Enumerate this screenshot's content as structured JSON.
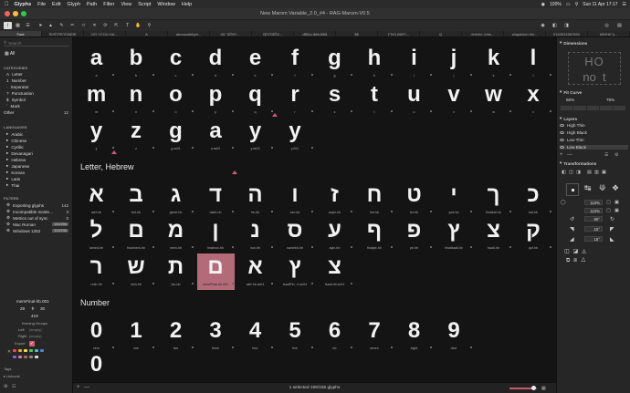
{
  "menubar": {
    "app": "Glyphs",
    "items": [
      "File",
      "Edit",
      "Glyph",
      "Path",
      "Filter",
      "View",
      "Script",
      "Window",
      "Help"
    ],
    "battery": "100%",
    "clock": "Sun 11 Apr  17:17"
  },
  "window": {
    "title": "New Marom Variable_2.0_#4 - RAG-Marom-V0.5"
  },
  "tabs": [
    "Font",
    "פנקאותהפדותאות",
    "DO YCOU HA...",
    "A",
    "abcasadefghi...",
    "ויאלטר עט ...",
    "עלסגדותבו...",
    "v$$4a-$8ie8l8$",
    "$$",
    "ראשון בארץ...",
    "Q",
    "Jericho John...",
    "shaydcion blo...",
    "0162634567890",
    "MWHKןך..."
  ],
  "sidebar": {
    "search_placeholder": "Search",
    "all_label": "All",
    "categories_title": "CATEGORIES",
    "categories": [
      {
        "label": "Letter",
        "icon": "A",
        "count": ""
      },
      {
        "label": "Number",
        "icon": "1",
        "count": ""
      },
      {
        "label": "Separator",
        "icon": "·",
        "count": ""
      },
      {
        "label": "Punctuation",
        "icon": "?",
        "count": ""
      },
      {
        "label": "Symbol",
        "icon": "$",
        "count": ""
      },
      {
        "label": "Mark",
        "icon": "´",
        "count": ""
      },
      {
        "label": "Other",
        "icon": "",
        "count": "12"
      }
    ],
    "languages_title": "LANGUAGES",
    "languages": [
      "Arabic",
      "Chinese",
      "Cyrillic",
      "Devanagari",
      "Hebrew",
      "Japanese",
      "Korean",
      "Latin",
      "Thai"
    ],
    "filters_title": "FILTERS",
    "filters": [
      {
        "label": "Exporting glyphs",
        "count": "142",
        "boxed": false
      },
      {
        "label": "Incompatible maste...",
        "count": "3",
        "boxed": false
      },
      {
        "label": "Metrics out of sync",
        "count": "0",
        "boxed": false
      },
      {
        "label": "Mac Roman",
        "count": "150/256",
        "boxed": true
      },
      {
        "label": "Windows 1252",
        "count": "102/236",
        "boxed": true
      }
    ],
    "glyph_info": {
      "name": "memFinal-hb.001",
      "lsb": "29",
      "rsb": "30",
      "width": "419",
      "kerning_title": "Kerning Groups",
      "left_label": "Left",
      "left_value": "(empty)",
      "right_label": "Right",
      "right_value": "(empty)",
      "export_label": "Export"
    },
    "tags_title": "Tags",
    "unicode_label": "Unicode"
  },
  "sections": {
    "hebrew_title": "Letter, Hebrew",
    "number_title": "Number"
  },
  "latin_row1": [
    {
      "g": "a",
      "n": "a"
    },
    {
      "g": "b",
      "n": "b"
    },
    {
      "g": "c",
      "n": "c"
    },
    {
      "g": "d",
      "n": "d"
    },
    {
      "g": "e",
      "n": "e"
    },
    {
      "g": "f",
      "n": "f"
    },
    {
      "g": "g",
      "n": "g"
    },
    {
      "g": "h",
      "n": "h"
    },
    {
      "g": "i",
      "n": "i"
    },
    {
      "g": "j",
      "n": "j"
    },
    {
      "g": "k",
      "n": "k"
    },
    {
      "g": "l",
      "n": "l"
    }
  ],
  "latin_row2": [
    {
      "g": "m",
      "n": "m"
    },
    {
      "g": "n",
      "n": "n"
    },
    {
      "g": "o",
      "n": "o"
    },
    {
      "g": "p",
      "n": "p"
    },
    {
      "g": "q",
      "n": "q"
    },
    {
      "g": "r",
      "n": "r"
    },
    {
      "g": "s",
      "n": "s"
    },
    {
      "g": "t",
      "n": "t"
    },
    {
      "g": "u",
      "n": "u"
    },
    {
      "g": "v",
      "n": "v"
    },
    {
      "g": "w",
      "n": "w"
    },
    {
      "g": "x",
      "n": "x"
    }
  ],
  "latin_row3": [
    {
      "g": "y",
      "n": "y"
    },
    {
      "g": "z",
      "n": "z"
    },
    {
      "g": "g",
      "n": "g.ss01"
    },
    {
      "g": "a",
      "n": "a.ss02"
    },
    {
      "g": "y",
      "n": "y.ss03"
    },
    {
      "g": "y",
      "n": "y.001"
    }
  ],
  "hebrew_row1": [
    {
      "g": "א",
      "n": "alef-hb"
    },
    {
      "g": "ב",
      "n": "bet-hb"
    },
    {
      "g": "ג",
      "n": "gimel-hb"
    },
    {
      "g": "ד",
      "n": "dalet-hb"
    },
    {
      "g": "ה",
      "n": "he-hb"
    },
    {
      "g": "ו",
      "n": "vav-hb"
    },
    {
      "g": "ז",
      "n": "zayin-hb"
    },
    {
      "g": "ח",
      "n": "het-hb"
    },
    {
      "g": "ט",
      "n": "tet-hb"
    },
    {
      "g": "י",
      "n": "yod-hb"
    },
    {
      "g": "ך",
      "n": "finalkaf-hb"
    },
    {
      "g": "כ",
      "n": "kaf-hb"
    }
  ],
  "hebrew_row2": [
    {
      "g": "ל",
      "n": "lamed-hb"
    },
    {
      "g": "ם",
      "n": "finalmem-hb"
    },
    {
      "g": "מ",
      "n": "mem-hb"
    },
    {
      "g": "ן",
      "n": "finalnun-hb"
    },
    {
      "g": "נ",
      "n": "nun-hb"
    },
    {
      "g": "ס",
      "n": "samekh-hb"
    },
    {
      "g": "ע",
      "n": "ayin-hb"
    },
    {
      "g": "ף",
      "n": "finalpe-hb"
    },
    {
      "g": "פ",
      "n": "pe-hb"
    },
    {
      "g": "ץ",
      "n": "finaltsadi-hb"
    },
    {
      "g": "צ",
      "n": "tsadi-hb"
    },
    {
      "g": "ק",
      "n": "qof-hb"
    }
  ],
  "hebrew_row3": [
    {
      "g": "ר",
      "n": "resh-hb"
    },
    {
      "g": "ש",
      "n": "shin-hb"
    },
    {
      "g": "ת",
      "n": "tav-hb"
    },
    {
      "g": "ם",
      "n": "memFinal-hb.001"
    },
    {
      "g": "א",
      "n": "alef-hb.ss04"
    },
    {
      "g": "ץ",
      "n": "tsadiFin...b.ss04"
    },
    {
      "g": "צ",
      "n": "tsadi-hb.ss04"
    }
  ],
  "number_row1": [
    {
      "g": "0",
      "n": "zero"
    },
    {
      "g": "1",
      "n": "one"
    },
    {
      "g": "2",
      "n": "two"
    },
    {
      "g": "3",
      "n": "three"
    },
    {
      "g": "4",
      "n": "four"
    },
    {
      "g": "5",
      "n": "five"
    },
    {
      "g": "6",
      "n": "six"
    },
    {
      "g": "7",
      "n": "seven"
    },
    {
      "g": "8",
      "n": "eight"
    },
    {
      "g": "9",
      "n": "nine"
    }
  ],
  "number_row2": [
    {
      "g": "0",
      "n": ""
    }
  ],
  "status": {
    "text": "1 selected 155/155 glyphs"
  },
  "right_panel": {
    "dimensions_title": "Dimensions",
    "dim_preview_top": "HO",
    "dim_preview_bottom": "no  t",
    "fitcurve_title": "Fit Curve",
    "fit_left": "56%",
    "fit_right": "75%",
    "layers_title": "Layers",
    "layers": [
      "High Thin",
      "High Black",
      "Low Thin",
      "Low Black"
    ],
    "transformations_title": "Transformations",
    "scale": "110%",
    "scale_y": "110%",
    "rotate": "90°",
    "slant": "15°",
    "slant_y": "15°"
  },
  "colors": {
    "selection": "#b46b79",
    "accent": "#d05a6a",
    "label_colors": [
      "#e05050",
      "#f0a040",
      "#f0e050",
      "#60c060",
      "#50c0c0",
      "#5080e0",
      "#9060d0",
      "#e070b0",
      "#a07050",
      "#888888",
      "#dddddd"
    ]
  }
}
